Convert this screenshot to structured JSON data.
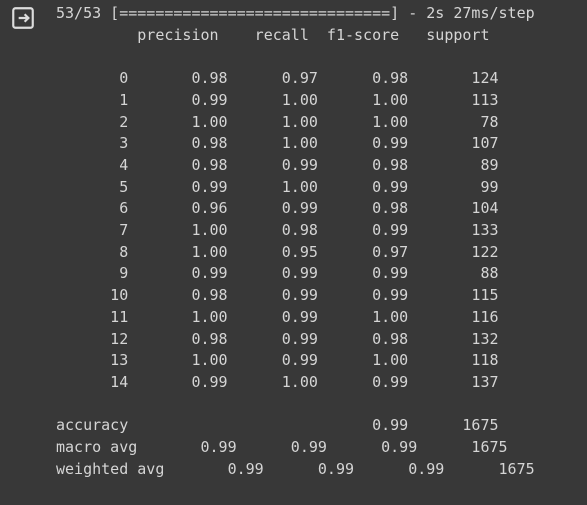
{
  "output": {
    "icon": "output-exit-icon",
    "progress_line": "53/53 [==============================] - 2s 27ms/step",
    "report_lines": [
      "         precision    recall  f1-score   support",
      "",
      "       0       0.98      0.97      0.98       124",
      "       1       0.99      1.00      1.00       113",
      "       2       1.00      1.00      1.00        78",
      "       3       0.98      1.00      0.99       107",
      "       4       0.98      0.99      0.98        89",
      "       5       0.99      1.00      0.99        99",
      "       6       0.96      0.99      0.98       104",
      "       7       1.00      0.98      0.99       133",
      "       8       1.00      0.95      0.97       122",
      "       9       0.99      0.99      0.99        88",
      "      10       0.98      0.99      0.99       115",
      "      11       1.00      0.99      1.00       116",
      "      12       0.98      0.99      0.98       132",
      "      13       1.00      0.99      1.00       118",
      "      14       0.99      1.00      0.99       137",
      "",
      "accuracy                           0.99      1675",
      "macro avg       0.99      0.99      0.99      1675",
      "weighted avg       0.99      0.99      0.99      1675"
    ]
  }
}
